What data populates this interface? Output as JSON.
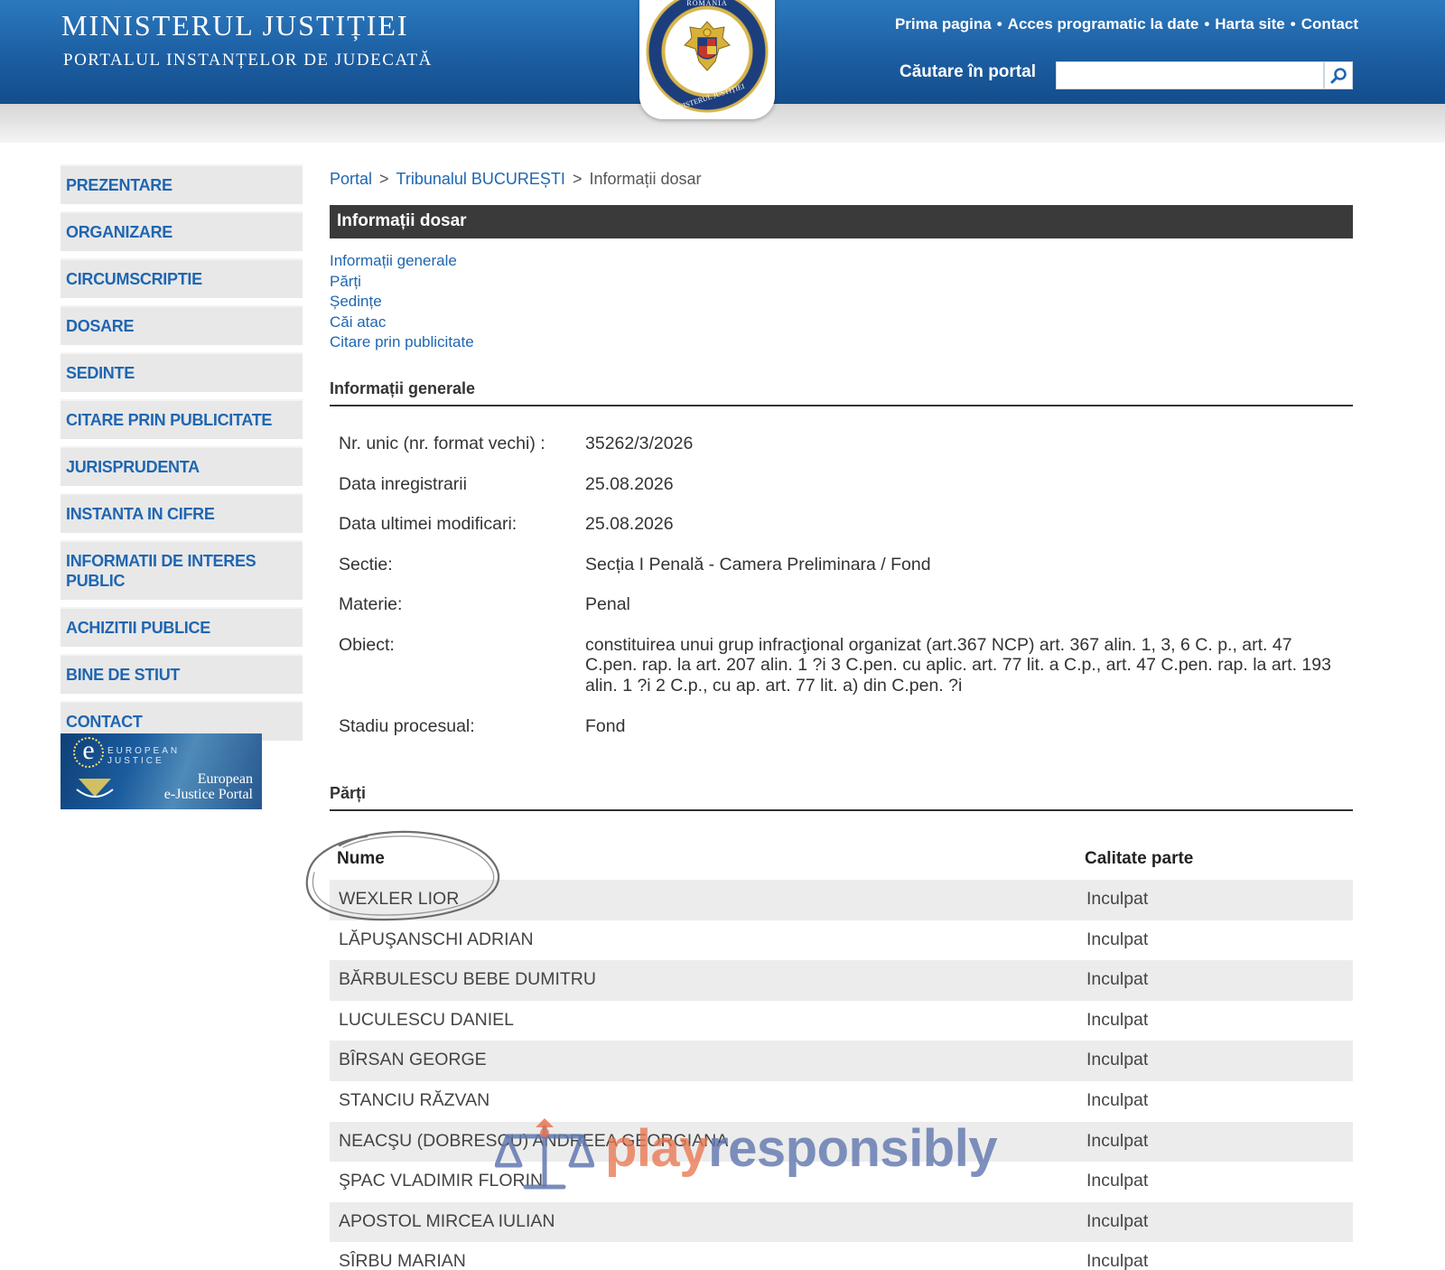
{
  "header": {
    "title": "MINISTERUL JUSTIȚIEI",
    "subtitle": "PORTALUL INSTANȚELOR DE JUDECATĂ",
    "emblem_text_top": "ROMÂNIA",
    "emblem_text_bottom": "MINISTERUL JUSTIȚIEI",
    "top_links": [
      "Prima pagina",
      "Acces programatic la date",
      "Harta site",
      "Contact"
    ],
    "search_label": "Căutare în portal",
    "search_value": "",
    "colors": {
      "header_blue": "#1c5ea2",
      "link_blue": "#1f66b1",
      "section_bar": "#3a3a3a"
    }
  },
  "sidebar": {
    "items": [
      {
        "label": "PREZENTARE"
      },
      {
        "label": "ORGANIZARE"
      },
      {
        "label": "CIRCUMSCRIPTIE"
      },
      {
        "label": "DOSARE"
      },
      {
        "label": "SEDINTE"
      },
      {
        "label": "CITARE PRIN PUBLICITATE"
      },
      {
        "label": "JURISPRUDENTA"
      },
      {
        "label": "INSTANTA IN CIFRE"
      },
      {
        "label": "INFORMATII DE INTERES PUBLIC"
      },
      {
        "label": "ACHIZITII PUBLICE"
      },
      {
        "label": "BINE DE STIUT"
      },
      {
        "label": "CONTACT"
      }
    ],
    "ejustice": {
      "logo_letter": "e",
      "logo_caption": "EUROPEAN JUSTICE",
      "portal_line1": "European",
      "portal_line2": "e-Justice Portal"
    }
  },
  "breadcrumb": {
    "items": [
      "Portal",
      "Tribunalul BUCUREȘTI",
      "Informații dosar"
    ],
    "separator": ">"
  },
  "main": {
    "section_title": "Informații dosar",
    "anchors": [
      "Informații generale",
      "Părți",
      "Ședințe",
      "Căi atac",
      "Citare prin publicitate"
    ],
    "general": {
      "heading": "Informații generale",
      "rows": [
        {
          "label": "Nr. unic (nr. format vechi) :",
          "value": "35262/3/2026"
        },
        {
          "label": "Data inregistrarii",
          "value": "25.08.2026"
        },
        {
          "label": "Data ultimei modificari:",
          "value": "25.08.2026"
        },
        {
          "label": "Sectie:",
          "value": "Secția I Penală - Camera Preliminara / Fond"
        },
        {
          "label": "Materie:",
          "value": "Penal"
        },
        {
          "label": "Obiect:",
          "value": "constituirea unui grup infracţional organizat (art.367 NCP) art. 367 alin. 1, 3, 6 C. p., art. 47 C.pen. rap. la art. 207 alin. 1 ?i 3 C.pen. cu aplic. art. 77 lit. a C.p., art. 47 C.pen. rap. la art. 193 alin. 1 ?i 2 C.p., cu ap. art. 77 lit. a) din C.pen. ?i"
        },
        {
          "label": "Stadiu procesual:",
          "value": "Fond"
        }
      ]
    },
    "parties": {
      "heading": "Părți",
      "col_name": "Nume",
      "col_role": "Calitate parte",
      "rows": [
        {
          "name": "WEXLER LIOR",
          "role": "Inculpat"
        },
        {
          "name": "LĂPUŞANSCHI ADRIAN",
          "role": "Inculpat"
        },
        {
          "name": "BĂRBULESCU BEBE DUMITRU",
          "role": "Inculpat"
        },
        {
          "name": "LUCULESCU DANIEL",
          "role": "Inculpat"
        },
        {
          "name": "BÎRSAN GEORGE",
          "role": "Inculpat"
        },
        {
          "name": "STANCIU RĂZVAN",
          "role": "Inculpat"
        },
        {
          "name": "NEACŞU (DOBRESCU) ANDREEA GEORGIANA",
          "role": "Inculpat"
        },
        {
          "name": "ŞPAC VLADIMIR FLORIN",
          "role": "Inculpat"
        },
        {
          "name": "APOSTOL MIRCEA IULIAN",
          "role": "Inculpat"
        },
        {
          "name": "SÎRBU MARIAN",
          "role": "Inculpat"
        }
      ]
    }
  },
  "watermark": {
    "part1": "play",
    "part2": "responsibly"
  }
}
